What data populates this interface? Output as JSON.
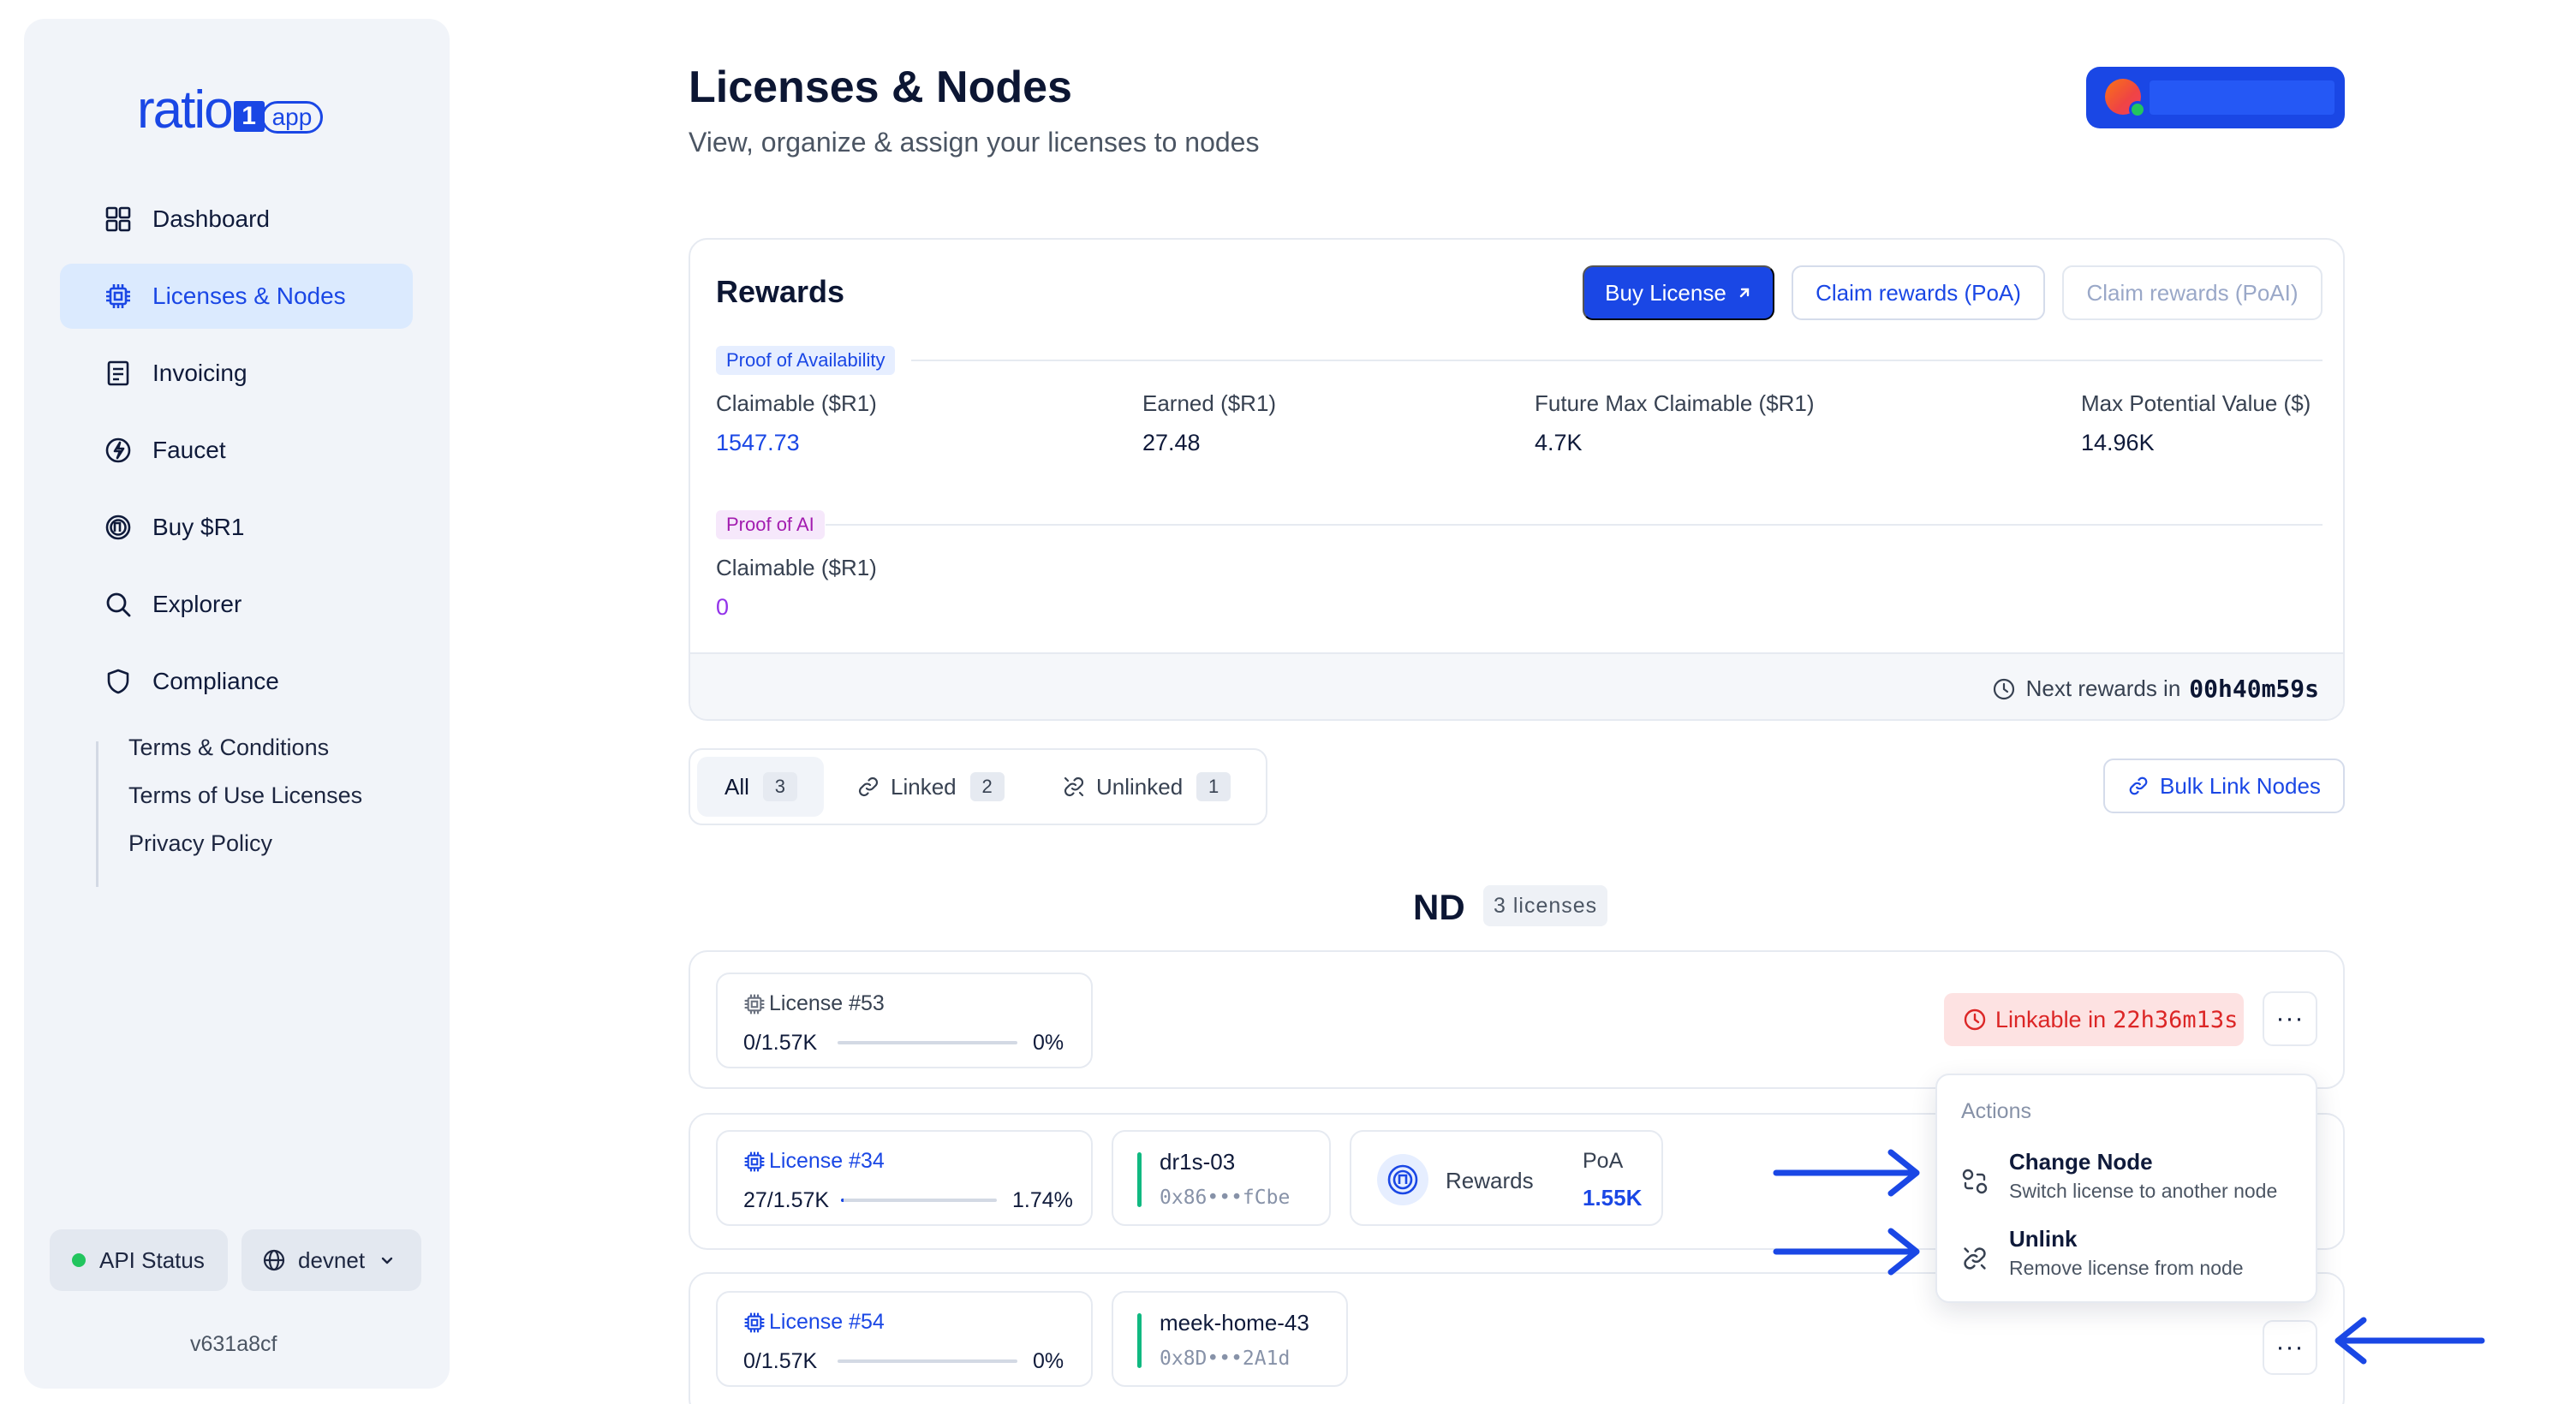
{
  "brand": {
    "word": "ratio",
    "one": "1",
    "app": "app"
  },
  "sidebar": {
    "items": [
      {
        "label": "Dashboard"
      },
      {
        "label": "Licenses & Nodes"
      },
      {
        "label": "Invoicing"
      },
      {
        "label": "Faucet"
      },
      {
        "label": "Buy $R1"
      },
      {
        "label": "Explorer"
      },
      {
        "label": "Compliance"
      }
    ],
    "compliance_links": [
      "Terms & Conditions",
      "Terms of Use Licenses",
      "Privacy Policy"
    ],
    "api_status": "API Status",
    "network": "devnet",
    "version": "v631a8cf"
  },
  "header": {
    "title": "Licenses & Nodes",
    "subtitle": "View, organize & assign your licenses to nodes"
  },
  "rewards": {
    "title": "Rewards",
    "buy_label": "Buy License",
    "claim_poa_label": "Claim rewards (PoA)",
    "claim_poai_label": "Claim rewards (PoAI)",
    "poa_tag": "Proof of Availability",
    "poa_metrics": [
      {
        "label": "Claimable ($R1)",
        "value": "1547.73"
      },
      {
        "label": "Earned ($R1)",
        "value": "27.48"
      },
      {
        "label": "Future Max Claimable ($R1)",
        "value": "4.7K"
      },
      {
        "label": "Max Potential Value ($)",
        "value": "14.96K"
      }
    ],
    "poai_tag": "Proof of AI",
    "poai_metric": {
      "label": "Claimable ($R1)",
      "value": "0"
    },
    "next_label": "Next rewards in",
    "next_value": "00h40m59s"
  },
  "filters": {
    "tabs": [
      {
        "label": "All",
        "count": "3"
      },
      {
        "label": "Linked",
        "count": "2"
      },
      {
        "label": "Unlinked",
        "count": "1"
      }
    ],
    "bulk_label": "Bulk Link Nodes"
  },
  "section": {
    "title": "ND",
    "count": "3 licenses"
  },
  "licenses": [
    {
      "name": "License #53",
      "amount": "0/1.57K",
      "pct": "0%",
      "progress": 0,
      "status_prefix": "Linkable in",
      "status_time": "22h36m13s"
    },
    {
      "name": "License #34",
      "amount": "27/1.57K",
      "pct": "1.74%",
      "progress": 0.0174,
      "node_name": "dr1s-03",
      "node_addr": "0x86•••fCbe",
      "rewards_label": "Rewards",
      "rewards_type": "PoA",
      "rewards_value": "1.55K"
    },
    {
      "name": "License #54",
      "amount": "0/1.57K",
      "pct": "0%",
      "progress": 0,
      "node_name": "meek-home-43",
      "node_addr": "0x8D•••2A1d"
    }
  ],
  "menu": {
    "header": "Actions",
    "items": [
      {
        "title": "Change Node",
        "desc": "Switch license to another node"
      },
      {
        "title": "Unlink",
        "desc": "Remove license from node"
      }
    ]
  },
  "more_glyph": "···",
  "colors": {
    "accent": "#1a47e5",
    "linked": "#10b981",
    "danger": "#dc2626",
    "purple": "#9333ea"
  }
}
